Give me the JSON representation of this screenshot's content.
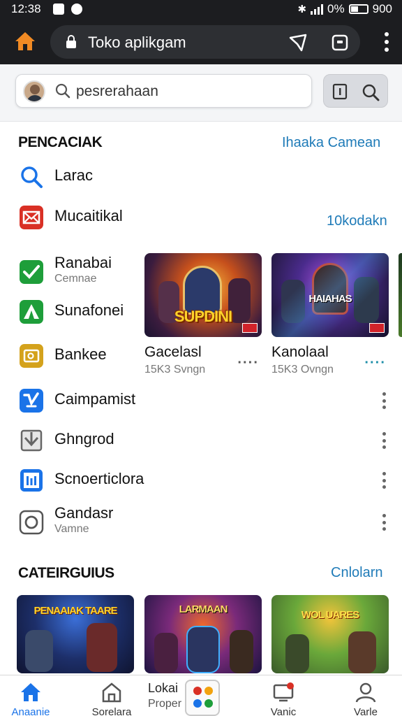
{
  "status_bar": {
    "time": "12:38",
    "battery": "0%",
    "extra": "900"
  },
  "browser": {
    "url": "Toko aplikgam"
  },
  "search": {
    "placeholder": "pesrerahaan",
    "value": "pesrerahaan"
  },
  "section_search": {
    "title": "PENCACIAK",
    "link": "Ihaaka Camean",
    "link2": "10kodakn"
  },
  "apps": [
    {
      "name": "Larac",
      "icon": "search-icon",
      "color": "#1a73e8"
    },
    {
      "name": "Mucaitikal",
      "icon": "mail-icon",
      "color": "#d93025"
    },
    {
      "name": "Ranabai",
      "sub": "Cemnae",
      "icon": "check-icon",
      "color": "#1e9e3a"
    },
    {
      "name": "Sunafonei",
      "icon": "tent-icon",
      "color": "#1e9e3a"
    },
    {
      "name": "Bankee",
      "icon": "wallet-icon",
      "color": "#d4a21c"
    },
    {
      "name": "Caimpamist",
      "icon": "shield-check-icon",
      "color": "#1a73e8"
    },
    {
      "name": "Ghngrod",
      "icon": "download-tray-icon",
      "color": "#666666"
    },
    {
      "name": "Scnoerticlora",
      "icon": "chart-icon",
      "color": "#1a73e8"
    },
    {
      "name": "Gandasr",
      "sub": "Vamne",
      "icon": "camera-icon",
      "color": "#555555"
    }
  ],
  "games": [
    {
      "title": "Gacelasl",
      "meta": "15K3 Svngn",
      "logo": "SUPDINI",
      "more": "····"
    },
    {
      "title": "Kanolaal",
      "meta": "15K3 Ovngn",
      "logo": "HAIAHAS",
      "more": "····"
    }
  ],
  "section_categories": {
    "title": "CATEIRGUIUS",
    "link": "Cnlolarn"
  },
  "categories": [
    {
      "logo": "PENAAIAK TAARE"
    },
    {
      "logo": "LARMAAN"
    },
    {
      "logo": "WOL UARES"
    }
  ],
  "bottom_nav": [
    {
      "label": "Anaanie",
      "icon": "home-icon"
    },
    {
      "label": "Sorelara",
      "icon": "store-icon"
    },
    {
      "label": "Lokai",
      "sub": "Proper",
      "icon": "apps-icon"
    },
    {
      "label": "Vanic",
      "icon": "device-icon"
    },
    {
      "label": "Varle",
      "icon": "person-icon"
    }
  ],
  "colors": {
    "accent": "#1a73e8",
    "link": "#1f7bb8",
    "home": "#f08a24"
  }
}
